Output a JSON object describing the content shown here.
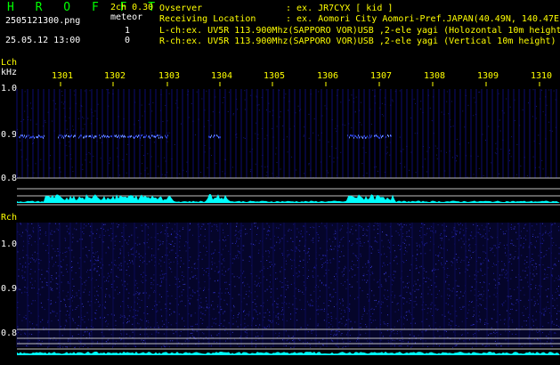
{
  "header": {
    "logo": "H R O F F T",
    "mode": "2ch 0.30",
    "meteor_label": "meteor",
    "filename": "2505121300.png",
    "datetime": "25.05.12 13:00",
    "meteor_counts": {
      "l": "1",
      "r": "0"
    }
  },
  "info": {
    "observer_label": "Ovserver",
    "observer_value": ": ex. JR7CYX [ kid ]",
    "location_label": "Receiving Location",
    "location_value": ": ex. Aomori City Aomori-Pref.JAPAN(40.49N, 140.47E)",
    "lch": "L-ch:ex. UV5R 113.900Mhz(SAPPORO VOR)USB ,2-ele yagi (Holozontal 10m height",
    "rch": "R-ch:ex. UV5R 113.900Mhz(SAPPORO VOR)USB ,2-ele yagi (Vertical 10m height)"
  },
  "time_ticks": [
    "1301",
    "1302",
    "1303",
    "1304",
    "1305",
    "1306",
    "1307",
    "1308",
    "1309",
    "1310"
  ],
  "lch": {
    "label": "Lch",
    "unit": "kHz",
    "freq_labels": [
      "1.0",
      "0.9",
      "0.8"
    ]
  },
  "rch": {
    "label": "Rch",
    "freq_labels": [
      "1.0",
      "0.9",
      "0.8"
    ]
  },
  "colors": {
    "logo": "#00ff00",
    "text": "#ffff00",
    "trace": "#00ffff",
    "noise": "#1a1aa0",
    "echo": "#3a5cff"
  }
}
